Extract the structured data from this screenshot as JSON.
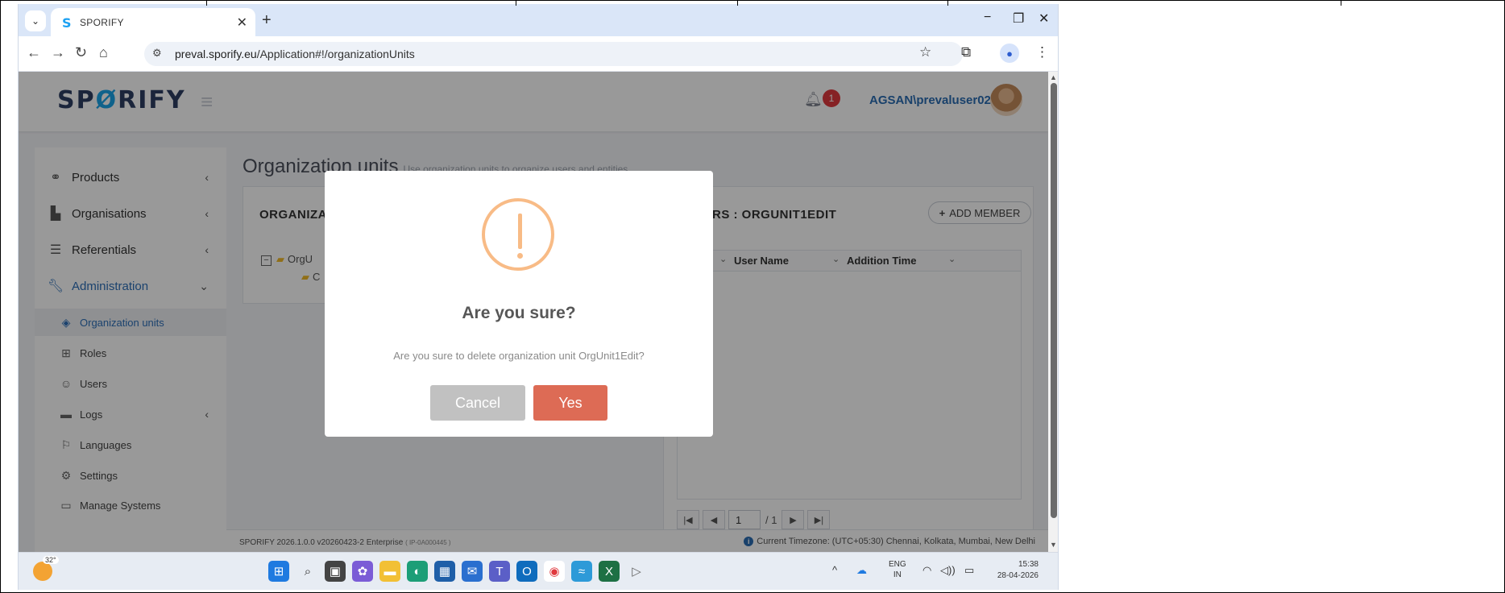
{
  "browser": {
    "tab_title": "SPORIFY",
    "tab_favicon": "S",
    "new_tab": "+",
    "url_host": "preval.sporify.eu",
    "url_path": "/Application#!/organizationUnits",
    "window_controls": [
      "−",
      "❐",
      "✕"
    ]
  },
  "app": {
    "logo_left": "SP",
    "logo_mid": "Ø",
    "logo_right": "RIFY",
    "notification_count": "1",
    "username": "AGSAN\\prevaluser02",
    "page_title": "Organization units",
    "page_subtitle": "Use organization units to organize users and entities"
  },
  "sidebar": {
    "items": [
      {
        "label": "Products",
        "icon": "products-icon"
      },
      {
        "label": "Organisations",
        "icon": "factory-icon"
      },
      {
        "label": "Referentials",
        "icon": "list-icon"
      },
      {
        "label": "Administration",
        "icon": "wrench-icon"
      }
    ],
    "sub_items": [
      {
        "label": "Organization units",
        "icon": "layers-icon"
      },
      {
        "label": "Roles",
        "icon": "roles-icon"
      },
      {
        "label": "Users",
        "icon": "users-icon"
      },
      {
        "label": "Logs",
        "icon": "logs-icon"
      },
      {
        "label": "Languages",
        "icon": "flag-icon"
      },
      {
        "label": "Settings",
        "icon": "gear-icon"
      },
      {
        "label": "Manage Systems",
        "icon": "laptop-icon"
      }
    ]
  },
  "left_panel": {
    "header": "ORGANIZA",
    "tree_root": "OrgU",
    "tree_child": "C"
  },
  "right_panel": {
    "header": "RS : ORGUNIT1EDIT",
    "add_member": "ADD MEMBER",
    "columns": [
      "User Name",
      "Addition Time"
    ],
    "pager_page": "1",
    "pager_total": "/ 1"
  },
  "footer": {
    "version": "SPORIFY 2026.1.0.0 v20260423-2 Enterprise",
    "version_small": "( IP-0A000445 )",
    "timezone": "Current Timezone: (UTC+05:30) Chennai, Kolkata, Mumbai, New Delhi"
  },
  "dialog": {
    "title": "Are you sure?",
    "text": "Are you sure to delete organization unit OrgUnit1Edit?",
    "cancel": "Cancel",
    "confirm": "Yes",
    "warning_color": "#f8bb86",
    "confirm_color": "#dd6b55"
  },
  "taskbar": {
    "temperature": "32°",
    "lang_top": "ENG",
    "lang_bottom": "IN",
    "time": "15:38",
    "date": "28-04-2026"
  }
}
